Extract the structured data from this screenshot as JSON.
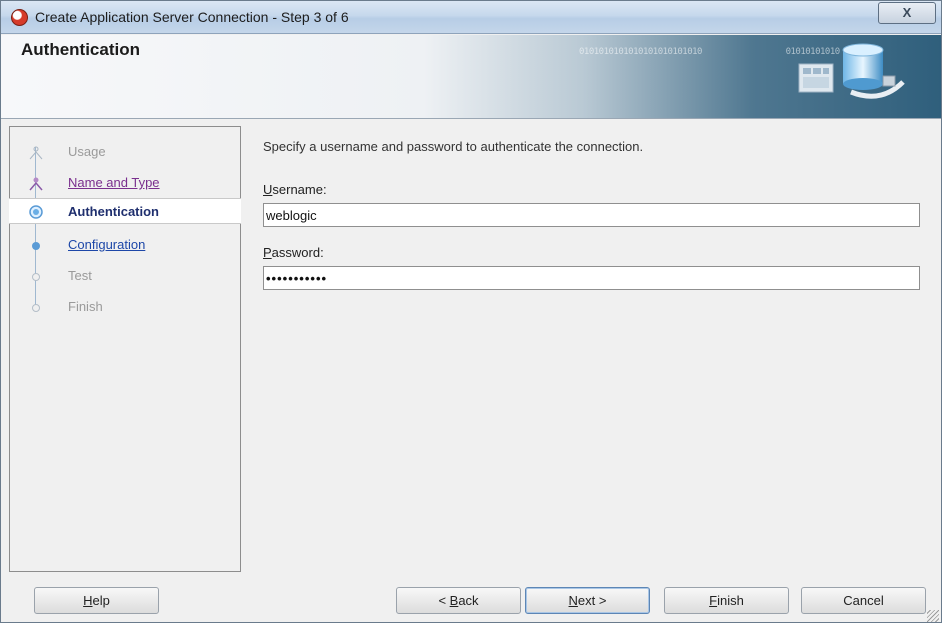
{
  "window": {
    "title": "Create Application Server Connection - Step 3 of 6",
    "close_label": "X"
  },
  "banner": {
    "title": "Authentication",
    "binary_text": "0101010101010101010101010                 01010101010"
  },
  "nav": {
    "items": [
      {
        "label": "Usage",
        "state": "disabled"
      },
      {
        "label": "Name and Type",
        "state": "visited"
      },
      {
        "label": "Authentication",
        "state": "current"
      },
      {
        "label": "Configuration",
        "state": "link"
      },
      {
        "label": "Test",
        "state": "disabled"
      },
      {
        "label": "Finish",
        "state": "disabled"
      }
    ]
  },
  "form": {
    "instruction": "Specify a username and password to authenticate the connection.",
    "username_label_first": "U",
    "username_label_rest": "sername:",
    "username_value": "weblogic",
    "password_label_first": "P",
    "password_label_rest": "assword:",
    "password_value": "•••••••••••"
  },
  "buttons": {
    "help_first": "H",
    "help_rest": "elp",
    "back_prefix": "< ",
    "back_first": "B",
    "back_rest": "ack",
    "next_first": "N",
    "next_rest": "ext >",
    "finish_first": "F",
    "finish_rest": "inish",
    "cancel": "Cancel"
  },
  "colors": {
    "link": "#1d47a8",
    "visited": "#7a2f8e",
    "current": "#1f2f6e",
    "disabled": "#9a9a9a",
    "accent": "#2f5f7c"
  },
  "icons": {
    "app": "oracle-app-icon",
    "banner": "database-connection-icon"
  }
}
